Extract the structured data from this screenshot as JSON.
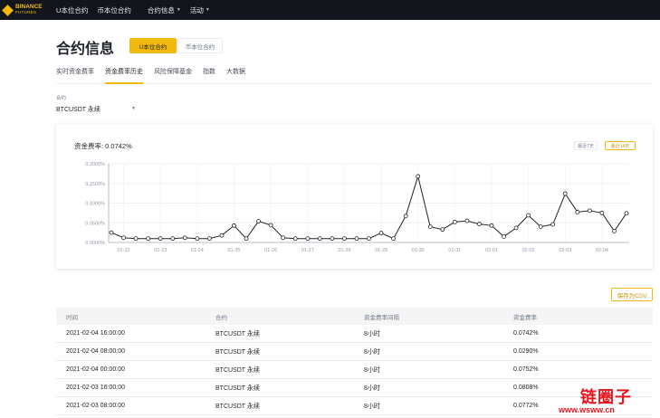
{
  "brand": {
    "line1": "BINANCE",
    "line2": "FUTURES"
  },
  "nav": {
    "item1": "U本位合约",
    "item2": "币本位合约",
    "item3": "合约信息",
    "item4": "活动"
  },
  "page": {
    "title": "合约信息",
    "seg_active": "U本位合约",
    "seg_inactive": "币本位合约"
  },
  "tabs": [
    "实时资金费率",
    "资金费率历史",
    "风险保障基金",
    "指数",
    "大数据"
  ],
  "contract": {
    "label": "合约",
    "value": "BTCUSDT 永续"
  },
  "chart": {
    "title": "资金费率: 0.0742%",
    "range7": "最近7天",
    "range14": "最近14天"
  },
  "chart_data": {
    "type": "line",
    "x_tick_labels": [
      "01-22",
      "01-23",
      "01-24",
      "01-25",
      "01-26",
      "01-27",
      "01-28",
      "01-29",
      "01-30",
      "01-31",
      "02-01",
      "02-02",
      "02-03",
      "02-04"
    ],
    "y_tick_labels": [
      "0.0000%",
      "0.0500%",
      "0.1000%",
      "0.1500%",
      "0.2000%"
    ],
    "ylim": [
      0,
      0.2
    ],
    "grid": true,
    "line_color": "#1e2329",
    "x": [
      "01-21 16:00",
      "01-22 00:00",
      "01-22 08:00",
      "01-22 16:00",
      "01-23 00:00",
      "01-23 08:00",
      "01-23 16:00",
      "01-24 00:00",
      "01-24 08:00",
      "01-24 16:00",
      "01-25 00:00",
      "01-25 08:00",
      "01-25 16:00",
      "01-26 00:00",
      "01-26 08:00",
      "01-26 16:00",
      "01-27 00:00",
      "01-27 08:00",
      "01-27 16:00",
      "01-28 00:00",
      "01-28 08:00",
      "01-28 16:00",
      "01-29 00:00",
      "01-29 08:00",
      "01-29 16:00",
      "01-30 00:00",
      "01-30 08:00",
      "01-30 16:00",
      "01-31 00:00",
      "01-31 08:00",
      "01-31 16:00",
      "02-01 00:00",
      "02-01 08:00",
      "02-01 16:00",
      "02-02 00:00",
      "02-02 08:00",
      "02-02 16:00",
      "02-03 00:00",
      "02-03 08:00",
      "02-03 16:00",
      "02-04 00:00",
      "02-04 08:00",
      "02-04 16:00"
    ],
    "values": [
      0.025,
      0.012,
      0.01,
      0.01,
      0.01,
      0.01,
      0.012,
      0.01,
      0.01,
      0.018,
      0.043,
      0.01,
      0.054,
      0.044,
      0.012,
      0.01,
      0.01,
      0.01,
      0.01,
      0.01,
      0.01,
      0.01,
      0.024,
      0.01,
      0.067,
      0.168,
      0.04,
      0.033,
      0.052,
      0.055,
      0.047,
      0.043,
      0.015,
      0.037,
      0.069,
      0.04,
      0.046,
      0.124,
      0.0772,
      0.0808,
      0.0752,
      0.029,
      0.0742
    ]
  },
  "actions": {
    "csv": "保存为CSV"
  },
  "table": {
    "headers": [
      "时间",
      "合约",
      "资金费率间隔",
      "资金费率"
    ],
    "rows": [
      [
        "2021-02-04 16:00:00",
        "BTCUSDT 永续",
        "8小时",
        "0.0742%"
      ],
      [
        "2021-02-04 08:00:00",
        "BTCUSDT 永续",
        "8小时",
        "0.0290%"
      ],
      [
        "2021-02-04 00:00:00",
        "BTCUSDT 永续",
        "8小时",
        "0.0752%"
      ],
      [
        "2021-02-03 16:00:00",
        "BTCUSDT 永续",
        "8小时",
        "0.0808%"
      ],
      [
        "2021-02-03 08:00:00",
        "BTCUSDT 永续",
        "8小时",
        "0.0772%"
      ]
    ]
  },
  "watermark": {
    "name": "链圈子",
    "url": "www.wsww.cn"
  }
}
